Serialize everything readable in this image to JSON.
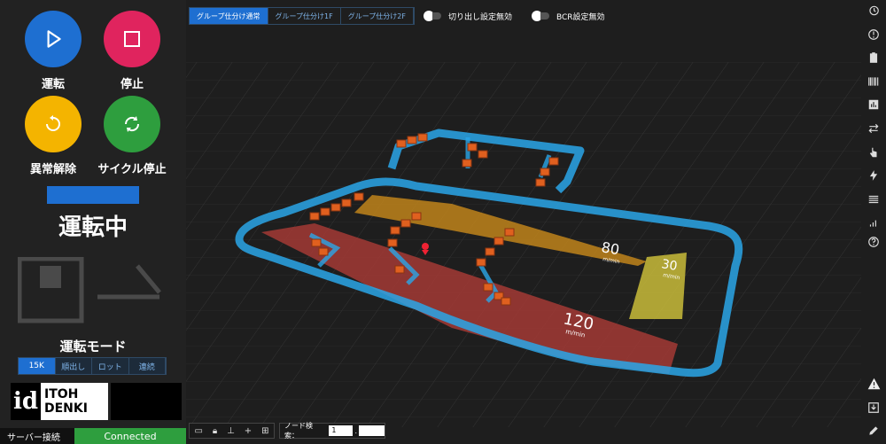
{
  "controls": {
    "run": "運転",
    "stop": "停止",
    "reset": "異常解除",
    "cycle_stop": "サイクル停止"
  },
  "status": {
    "text": "運転中"
  },
  "mode": {
    "title": "運転モード",
    "tabs": [
      "15K",
      "順出し",
      "ロット",
      "連続"
    ],
    "active": "15K"
  },
  "logo": {
    "mark": "id",
    "line1": "ITOH",
    "line2": "DENKI"
  },
  "footer": {
    "label": "サーバー接続",
    "status": "Connected"
  },
  "top": {
    "group_tabs": [
      "グループ仕分け通常",
      "グループ仕分け1F",
      "グループ仕分け2F"
    ],
    "toggle1": "切り出し設定無効",
    "toggle2": "BCR設定無効"
  },
  "zones": [
    {
      "speed": "80",
      "unit": "m/min",
      "color": "#c98a1a"
    },
    {
      "speed": "30",
      "unit": "m/min",
      "color": "#c9bc3a"
    },
    {
      "speed": "120",
      "unit": "m/min",
      "color": "#a33a35"
    }
  ],
  "node_search": {
    "label": "ノード検索：",
    "value": "1",
    "sep": "."
  },
  "tools_icons": [
    "minus-box-icon",
    "lock-icon",
    "align-bottom-icon",
    "plus-icon",
    "add-box-icon"
  ],
  "right_icons": [
    "history-icon",
    "alert-circle-icon",
    "clipboard-icon",
    "barcode-icon",
    "bar-chart-icon",
    "swap-icon",
    "touch-icon",
    "bolt-icon",
    "list-icon",
    "signal-icon",
    "help-icon",
    "warning-icon",
    "download-icon",
    "edit-icon"
  ],
  "colors": {
    "accent": "#1e6fd1",
    "run": "#1e6fd1",
    "stop": "#e0245e",
    "reset": "#f4b400",
    "cycle": "#2e9e3e",
    "conveyor": "#2aa6e8",
    "box": "#e0601f"
  }
}
